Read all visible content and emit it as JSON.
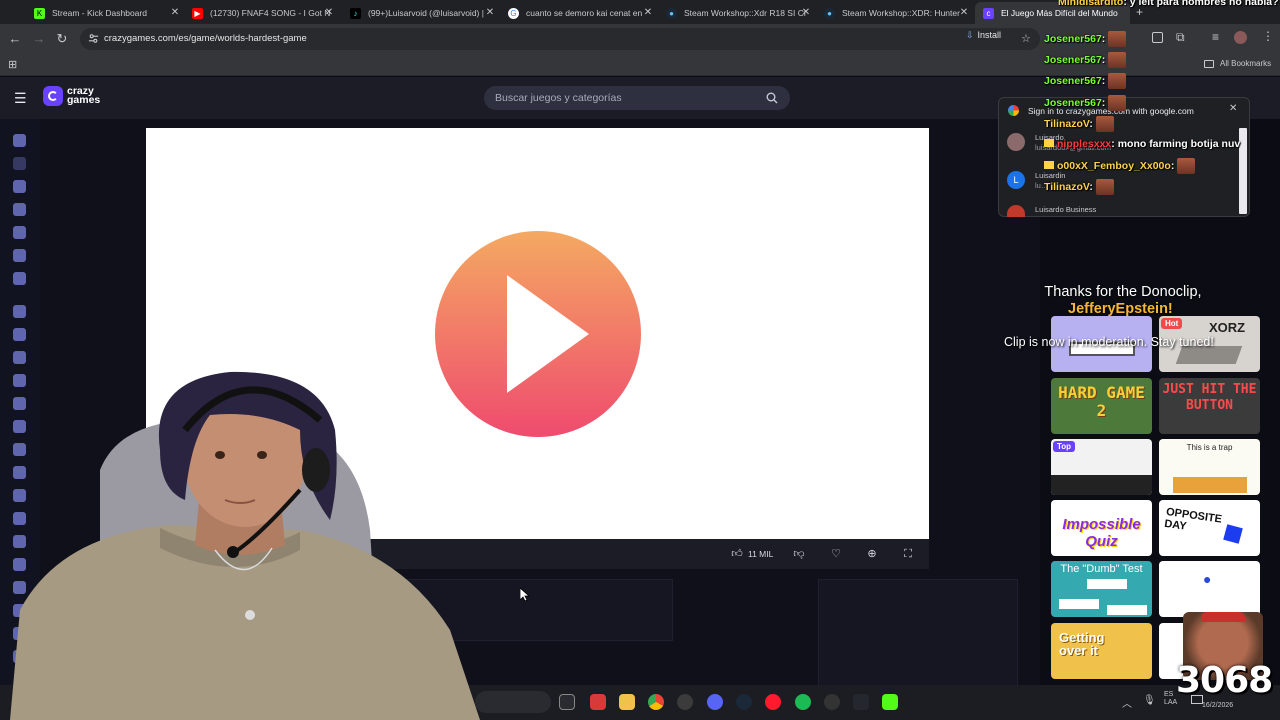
{
  "browser": {
    "tabs": [
      {
        "title": "Stream - Kick Dashboard",
        "color": "#53fc18",
        "active": false
      },
      {
        "title": "(12730) FNAF4 SONG - I Got N",
        "color": "#ff0000",
        "active": false
      },
      {
        "title": "(99+)Luisarvoid (@luisarvoid) |",
        "color": "#000000",
        "active": false
      },
      {
        "title": "cuanto se demoro kai cenat en",
        "color": "#4285f4",
        "active": false
      },
      {
        "title": "Steam Workshop::Xdr R18 SI Cl",
        "color": "#1b2838",
        "active": false
      },
      {
        "title": "Steam Workshop::XDR: Hunter",
        "color": "#1b2838",
        "active": false
      },
      {
        "title": "El Juego Más Difícil del Mundo",
        "color": "#6842ff",
        "active": true
      }
    ],
    "url": "crazygames.com/es/game/worlds-hardest-game",
    "install_label": "Install",
    "bookmarks_label": "All Bookmarks"
  },
  "site": {
    "logo_line1": "crazy",
    "logo_line2": "games",
    "search_placeholder": "Buscar juegos y categorías"
  },
  "game": {
    "likes": "11 MIL",
    "play_colors": [
      "#f4a25e",
      "#ef4d6e"
    ]
  },
  "signin_popup": {
    "title": "Sign in to crazygames.com with google.com",
    "accounts": [
      {
        "name": "Luisardo",
        "email": "luisardook@gmail.com",
        "initial": ""
      },
      {
        "name": "Luisardin",
        "email": "lu…",
        "initial": "L"
      },
      {
        "name": "Luisardo Business",
        "email": "",
        "initial": ""
      }
    ]
  },
  "chat": {
    "lines": [
      {
        "user": "Minidisardito",
        "msg": ": y leit para nombres no había?",
        "color": "#ffd24a"
      },
      {
        "user": "Josener567",
        "msg": ":",
        "color": "#7bff2e"
      },
      {
        "user": "Josener567",
        "msg": ":",
        "color": "#7bff2e"
      },
      {
        "user": "Josener567",
        "msg": ":",
        "color": "#7bff2e"
      },
      {
        "user": "Josener567",
        "msg": ":",
        "color": "#7bff2e"
      },
      {
        "user": "TilinazoV",
        "msg": ":",
        "color": "#ffd24a"
      },
      {
        "user": "nipplesxxx",
        "msg": ": mono farming botija nuv",
        "color": "#ff3b3b"
      },
      {
        "user": "o00xX_Femboy_Xx00o",
        "msg": ":",
        "color": "#ffd24a"
      },
      {
        "user": "TilinazoV",
        "msg": ":",
        "color": "#ffd24a"
      }
    ]
  },
  "donation": {
    "thanks": "Thanks for the Donoclip,",
    "name": "JefferyEpstein!",
    "status": "Clip is now in moderation. Stay tuned!"
  },
  "thumbs": [
    {
      "label": "",
      "badge": "",
      "bg": "#b7b1f2"
    },
    {
      "label": "XORZ",
      "badge": "Hot",
      "bg": "#d7d3cf"
    },
    {
      "label": "HARD GAME 2",
      "badge": "",
      "bg": "#4d7a3a"
    },
    {
      "label": "JUST HIT THE BUTTON",
      "badge": "",
      "bg": "#3b3b3b"
    },
    {
      "label": "",
      "badge": "Top",
      "bg": "#f2f2f2"
    },
    {
      "label": "This is a trap",
      "badge": "",
      "bg": "#fbfbf4"
    },
    {
      "label": "Impossible Quiz",
      "badge": "",
      "bg": "#ffffff"
    },
    {
      "label": "OPPOSITE DAY",
      "badge": "",
      "bg": "#ffffff"
    },
    {
      "label": "The \"Dumb\" Test",
      "badge": "",
      "bg": "#35a9b0"
    },
    {
      "label": "",
      "badge": "",
      "bg": "#ffffff"
    },
    {
      "label": "Getting over it",
      "badge": "",
      "bg": "#f1c24b"
    },
    {
      "label": "",
      "badge": "",
      "bg": "#ffffff"
    }
  ],
  "overlay_number": "3068",
  "tray": {
    "lang": "ES LAA",
    "time": "",
    "date": "16/2/2026"
  }
}
